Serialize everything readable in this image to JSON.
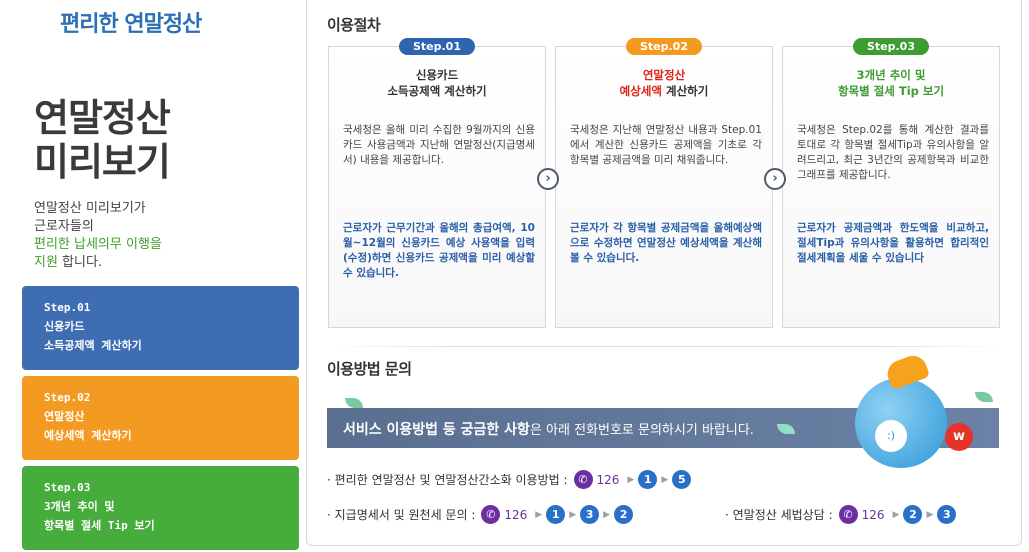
{
  "left": {
    "brand": "편리한 연말정산",
    "title_line1": "연말정산",
    "title_line2": "미리보기",
    "desc_line1": "연말정산 미리보기가",
    "desc_line2": "근로자들의",
    "desc_line3_green": "편리한 납세의무 이행을",
    "desc_line4_green": "지원",
    "desc_line4_rest": " 합니다.",
    "steps": [
      {
        "line1": "Step.01",
        "line2": "신용카드",
        "line3": "소득공제액 계산하기"
      },
      {
        "line1": "Step.02",
        "line2": "연말정산",
        "line3": "예상세액 계산하기"
      },
      {
        "line1": "Step.03",
        "line2": "3개년 추이 및",
        "line3": "항목별 절세 Tip 보기"
      }
    ]
  },
  "main": {
    "section1_title": "이용절차",
    "section2_title": "이용방법 문의",
    "cards": [
      {
        "pill": "Step.01",
        "title_line1": "신용카드",
        "title_line2": "소득공제액 계산하기",
        "p1": "국세청은 올해 미리 수집한 9월까지의 신용카드 사용금액과 지난해 연말정산(지급명세서) 내용을 제공합니다.",
        "p2": "근로자가 근무기간과 올해의 총급여액, 10월~12월의 신용카드 예상 사용액을 입력(수정)하면 신용카드 공제액을 미리 예상할 수 있습니다."
      },
      {
        "pill": "Step.02",
        "title_line1": "연말정산",
        "title_line2_red": "예상세액",
        "title_line2_rest": " 계산하기",
        "p1": "국세청은 지난해 연말정산 내용과 Step.01에서 계산한 신용카드 공제액을 기초로 각 항목별 공제금액을 미리 채워줍니다.",
        "p2": "근로자가 각 항목별 공제금액을 올해예상액으로 수정하면 연말정산 예상세액을 계산해 볼 수 있습니다."
      },
      {
        "pill": "Step.03",
        "title_line1": "3개년 추이 및",
        "title_line2": "항목별 절세 Tip 보기",
        "p1": "국세청은 Step.02를 통해 계산한 결과를 토대로 각 항목별 절세Tip과 유의사항을 알려드리고, 최근 3년간의 공제항목과 비교한 그래프를 제공합니다.",
        "p2": "근로자가 공제금액과 한도액을 비교하고, 절세Tip과 유의사항을 활용하면 합리적인 절세계획을 세울 수 있습니다"
      }
    ],
    "arrow_glyph": "›",
    "banner_bold": "서비스 이용방법 등 궁금한 사항",
    "banner_rest": "은 아래 전화번호로 문의하시기 바랍니다.",
    "badge_w": "w",
    "info1": {
      "label": "· 편리한 연말정산 및 연말정산간소화 이용방법 :",
      "number": "126",
      "steps": [
        "1",
        "5"
      ]
    },
    "info2": {
      "label": "· 지급명세서 및 원천세 문의 :",
      "number": "126",
      "steps": [
        "1",
        "3",
        "2"
      ]
    },
    "info3": {
      "label": "· 연말정산 세법상담 :",
      "number": "126",
      "steps": [
        "2",
        "3"
      ]
    }
  },
  "colors": {
    "step1": "#3f6db2",
    "step2": "#f39a22",
    "step3": "#46ac3b",
    "brand": "#2b6fb6",
    "phone": "#6b2fa1",
    "circle": "#2870c8"
  },
  "icons": [
    "phone-icon",
    "arrow-right-icon",
    "chat-bubble-icon"
  ]
}
